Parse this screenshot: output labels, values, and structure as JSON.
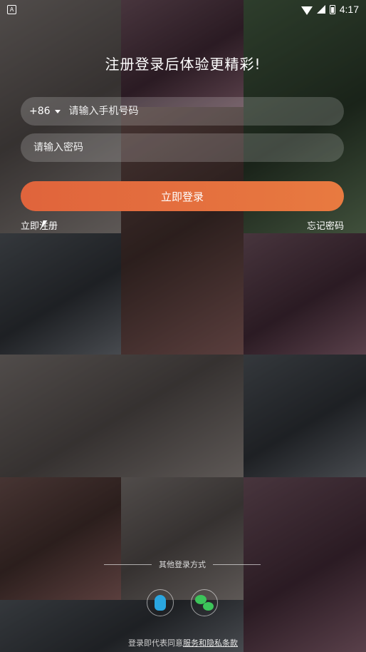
{
  "status_bar": {
    "time": "4:17",
    "notification_label": "A"
  },
  "title": "注册登录后体验更精彩!",
  "phone_field": {
    "country_code": "+86",
    "placeholder": "请输入手机号码",
    "value": ""
  },
  "password_field": {
    "placeholder": "请输入密码",
    "value": ""
  },
  "login_button": "立即登录",
  "register_link": "立即注册",
  "forgot_link": "忘记密码",
  "other_login": {
    "label": "其他登录方式",
    "options": [
      "qq-icon",
      "wechat-icon"
    ]
  },
  "agreement": {
    "prefix": "登录即代表同意",
    "link": "服务和隐私条款"
  },
  "colors": {
    "accent": "#E66E3E",
    "qq": "#2AA6E0",
    "wechat": "#3CC45A"
  }
}
